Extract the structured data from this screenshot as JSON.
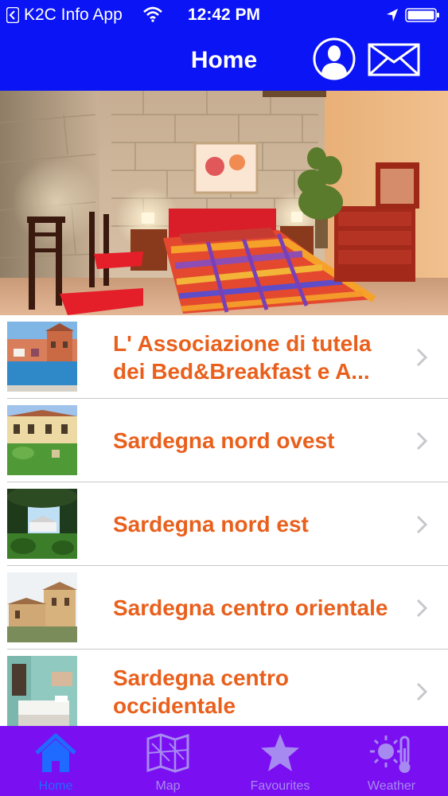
{
  "status_bar": {
    "app_name": "K2C Info App",
    "time": "12:42 PM"
  },
  "nav": {
    "title": "Home",
    "profile_icon": "person-circle-icon",
    "mail_icon": "envelope-icon"
  },
  "list": {
    "items": [
      {
        "title": "L' Associazione di tutela dei Bed&Breakfast e A..."
      },
      {
        "title": "Sardegna nord ovest"
      },
      {
        "title": "Sardegna nord est"
      },
      {
        "title": "Sardegna centro orientale"
      },
      {
        "title": "Sardegna centro occidentale"
      }
    ]
  },
  "tabs": [
    {
      "label": "Home",
      "icon": "house-icon",
      "active": true
    },
    {
      "label": "Map",
      "icon": "map-icon",
      "active": false
    },
    {
      "label": "Favourites",
      "icon": "star-icon",
      "active": false
    },
    {
      "label": "Weather",
      "icon": "weather-icon",
      "active": false
    }
  ],
  "colors": {
    "bar_blue": "#0a14f4",
    "tab_purple": "#7a0ff2",
    "item_text": "#e9601d",
    "tab_active": "#1f6bff",
    "tab_inactive": "#a68af0"
  }
}
